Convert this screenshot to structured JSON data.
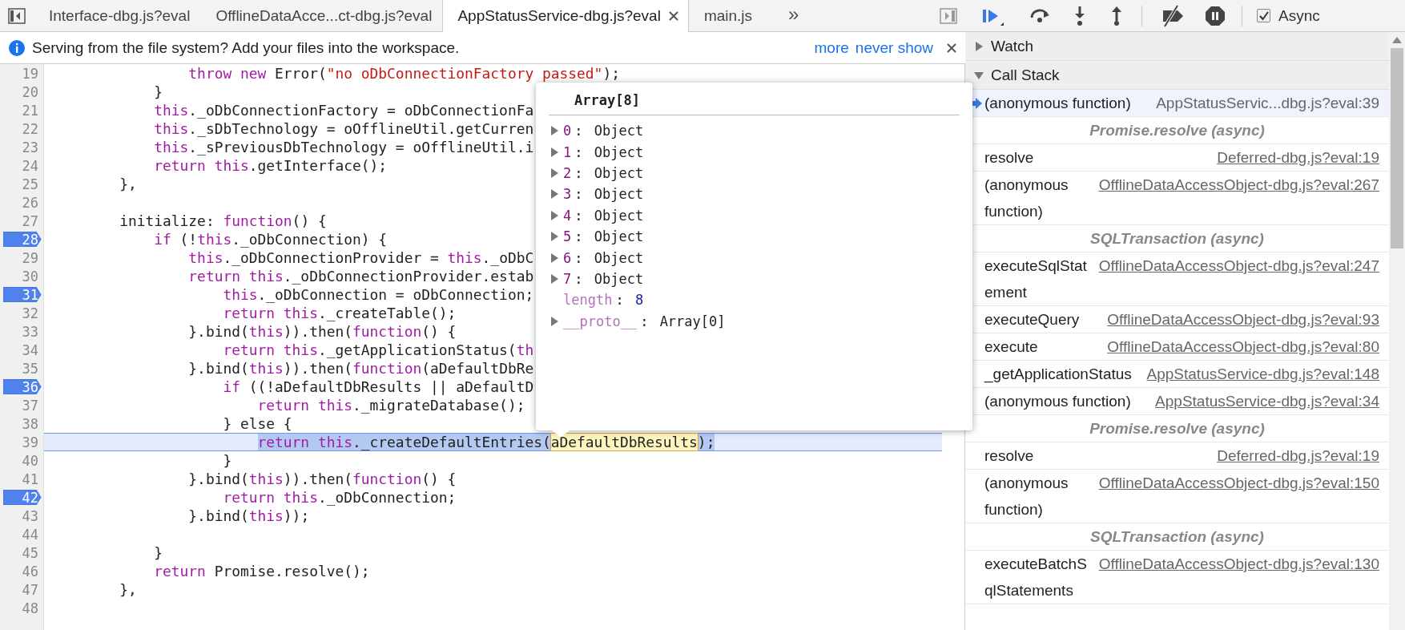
{
  "tabs": [
    {
      "label": "Interface-dbg.js?eval",
      "selected": false
    },
    {
      "label": "OfflineDataAcce...ct-dbg.js?eval",
      "selected": false
    },
    {
      "label": "AppStatusService-dbg.js?eval",
      "selected": true
    },
    {
      "label": "main.js",
      "selected": false
    }
  ],
  "more_tabs": "»",
  "info_bar": {
    "message": "Serving from the file system? Add your files into the workspace.",
    "links": [
      "more",
      "never show"
    ]
  },
  "editor": {
    "lines": [
      {
        "number": "19",
        "breakpoint": false,
        "current": false,
        "tokens": [
          {
            "text": "                throw new",
            "kind": "keyword"
          },
          {
            "text": " Error(",
            "kind": "plain"
          },
          {
            "text": "\"no oDbConnectionFactory passed\"",
            "kind": "string"
          },
          {
            "text": ");",
            "kind": "plain"
          }
        ]
      },
      {
        "number": "20",
        "breakpoint": false,
        "current": false,
        "tokens": [
          {
            "text": "            }",
            "kind": "plain"
          }
        ]
      },
      {
        "number": "21",
        "breakpoint": false,
        "current": false,
        "tokens": [
          {
            "text": "            this",
            "kind": "keyword"
          },
          {
            "text": "._oDbConnectionFactory = oDbConnectionFa",
            "kind": "plain"
          }
        ]
      },
      {
        "number": "22",
        "breakpoint": false,
        "current": false,
        "tokens": [
          {
            "text": "            this",
            "kind": "keyword"
          },
          {
            "text": "._sDbTechnology = oOfflineUtil.getCurren",
            "kind": "plain"
          }
        ]
      },
      {
        "number": "23",
        "breakpoint": false,
        "current": false,
        "tokens": [
          {
            "text": "            this",
            "kind": "keyword"
          },
          {
            "text": "._sPreviousDbTechnology = oOfflineUtil.i",
            "kind": "plain"
          }
        ]
      },
      {
        "number": "24",
        "breakpoint": false,
        "current": false,
        "tokens": [
          {
            "text": "            return this",
            "kind": "keyword"
          },
          {
            "text": ".getInterface();",
            "kind": "plain"
          }
        ]
      },
      {
        "number": "25",
        "breakpoint": false,
        "current": false,
        "tokens": [
          {
            "text": "        },",
            "kind": "plain"
          }
        ]
      },
      {
        "number": "26",
        "breakpoint": false,
        "current": false
      },
      {
        "number": "27",
        "breakpoint": false,
        "current": false,
        "tokens": [
          {
            "text": "        initialize: ",
            "kind": "plain"
          },
          {
            "text": "function",
            "kind": "keyword"
          },
          {
            "text": "() {",
            "kind": "plain"
          }
        ]
      },
      {
        "number": "28",
        "breakpoint": true,
        "current": false,
        "tokens": [
          {
            "text": "            if",
            "kind": "keyword"
          },
          {
            "text": " (!",
            "kind": "plain"
          },
          {
            "text": "this",
            "kind": "keyword"
          },
          {
            "text": "._oDbConnection) {",
            "kind": "plain"
          }
        ]
      },
      {
        "number": "29",
        "breakpoint": false,
        "current": false,
        "tokens": [
          {
            "text": "                this",
            "kind": "keyword"
          },
          {
            "text": "._oDbConnectionProvider = ",
            "kind": "plain"
          },
          {
            "text": "this",
            "kind": "keyword"
          },
          {
            "text": "._oDbC",
            "kind": "plain"
          }
        ]
      },
      {
        "number": "30",
        "breakpoint": false,
        "current": false,
        "tokens": [
          {
            "text": "                return this",
            "kind": "keyword"
          },
          {
            "text": "._oDbConnectionProvider.estab",
            "kind": "plain"
          }
        ]
      },
      {
        "number": "31",
        "breakpoint": true,
        "current": false,
        "tokens": [
          {
            "text": "                    this",
            "kind": "keyword"
          },
          {
            "text": "._oDbConnection = oDbConnection;",
            "kind": "plain"
          }
        ]
      },
      {
        "number": "32",
        "breakpoint": false,
        "current": false,
        "tokens": [
          {
            "text": "                    return this",
            "kind": "keyword"
          },
          {
            "text": "._createTable();",
            "kind": "plain"
          }
        ]
      },
      {
        "number": "33",
        "breakpoint": false,
        "current": false,
        "tokens": [
          {
            "text": "                }.bind(",
            "kind": "plain"
          },
          {
            "text": "this",
            "kind": "keyword"
          },
          {
            "text": ")).then(",
            "kind": "plain"
          },
          {
            "text": "function",
            "kind": "keyword"
          },
          {
            "text": "() {",
            "kind": "plain"
          }
        ]
      },
      {
        "number": "34",
        "breakpoint": false,
        "current": false,
        "tokens": [
          {
            "text": "                    return this",
            "kind": "keyword"
          },
          {
            "text": "._getApplicationStatus(",
            "kind": "plain"
          },
          {
            "text": "th",
            "kind": "keyword"
          }
        ]
      },
      {
        "number": "35",
        "breakpoint": false,
        "current": false,
        "tokens": [
          {
            "text": "                }.bind(",
            "kind": "plain"
          },
          {
            "text": "this",
            "kind": "keyword"
          },
          {
            "text": ")).then(",
            "kind": "plain"
          },
          {
            "text": "function",
            "kind": "keyword"
          },
          {
            "text": "(aDefaultDbRe",
            "kind": "plain"
          }
        ]
      },
      {
        "number": "36",
        "breakpoint": true,
        "current": false,
        "tokens": [
          {
            "text": "                    if",
            "kind": "keyword"
          },
          {
            "text": " ((!aDefaultDbResults || aDefaultD",
            "kind": "plain"
          }
        ]
      },
      {
        "number": "37",
        "breakpoint": false,
        "current": false,
        "tokens": [
          {
            "text": "                        return this",
            "kind": "keyword"
          },
          {
            "text": "._migrateDatabase();",
            "kind": "plain"
          }
        ]
      },
      {
        "number": "38",
        "breakpoint": false,
        "current": false,
        "tokens": [
          {
            "text": "                    } else {",
            "kind": "plain"
          }
        ]
      },
      {
        "number": "39",
        "breakpoint": false,
        "current": true,
        "tokens": [
          {
            "text": "                        return this",
            "kind": "keyword",
            "in_selection": true
          },
          {
            "text": "._createDefaultEntries(",
            "kind": "plain",
            "in_selection": true
          },
          {
            "text": "aDefaultDbResults",
            "kind": "plain",
            "hovered": true
          },
          {
            "text": ");",
            "kind": "plain",
            "in_selection": true
          }
        ]
      },
      {
        "number": "40",
        "breakpoint": false,
        "current": false,
        "tokens": [
          {
            "text": "                    }",
            "kind": "plain"
          }
        ]
      },
      {
        "number": "41",
        "breakpoint": false,
        "current": false,
        "tokens": [
          {
            "text": "                }.bind(",
            "kind": "plain"
          },
          {
            "text": "this",
            "kind": "keyword"
          },
          {
            "text": ")).then(",
            "kind": "plain"
          },
          {
            "text": "function",
            "kind": "keyword"
          },
          {
            "text": "() {",
            "kind": "plain"
          }
        ]
      },
      {
        "number": "42",
        "breakpoint": true,
        "current": false,
        "tokens": [
          {
            "text": "                    return this",
            "kind": "keyword"
          },
          {
            "text": "._oDbConnection;",
            "kind": "plain"
          }
        ]
      },
      {
        "number": "43",
        "breakpoint": false,
        "current": false,
        "tokens": [
          {
            "text": "                }.bind(",
            "kind": "plain"
          },
          {
            "text": "this",
            "kind": "keyword"
          },
          {
            "text": "));",
            "kind": "plain"
          }
        ]
      },
      {
        "number": "44",
        "breakpoint": false,
        "current": false
      },
      {
        "number": "45",
        "breakpoint": false,
        "current": false,
        "tokens": [
          {
            "text": "            }",
            "kind": "plain"
          }
        ]
      },
      {
        "number": "46",
        "breakpoint": false,
        "current": false,
        "tokens": [
          {
            "text": "            return",
            "kind": "keyword"
          },
          {
            "text": " Promise.resolve();",
            "kind": "plain"
          }
        ]
      },
      {
        "number": "47",
        "breakpoint": false,
        "current": false,
        "tokens": [
          {
            "text": "        },",
            "kind": "plain"
          }
        ]
      },
      {
        "number": "48",
        "breakpoint": false,
        "current": false
      }
    ]
  },
  "popover": {
    "title": "Array[8]",
    "entries": [
      {
        "key": "0",
        "sep": ":",
        "value": "Object",
        "expandable": true,
        "kind": "index"
      },
      {
        "key": "1",
        "sep": ":",
        "value": "Object",
        "expandable": true,
        "kind": "index"
      },
      {
        "key": "2",
        "sep": ":",
        "value": "Object",
        "expandable": true,
        "kind": "index"
      },
      {
        "key": "3",
        "sep": ":",
        "value": "Object",
        "expandable": true,
        "kind": "index"
      },
      {
        "key": "4",
        "sep": ":",
        "value": "Object",
        "expandable": true,
        "kind": "index"
      },
      {
        "key": "5",
        "sep": ":",
        "value": "Object",
        "expandable": true,
        "kind": "index"
      },
      {
        "key": "6",
        "sep": ":",
        "value": "Object",
        "expandable": true,
        "kind": "index"
      },
      {
        "key": "7",
        "sep": ":",
        "value": "Object",
        "expandable": true,
        "kind": "index"
      },
      {
        "key": "length",
        "sep": ":",
        "value": "8",
        "expandable": false,
        "kind": "internal_number"
      },
      {
        "key": "__proto__",
        "sep": ":",
        "value": "Array[0]",
        "expandable": true,
        "kind": "internal"
      }
    ]
  },
  "debugger": {
    "async": {
      "label": "Async",
      "checked": true
    },
    "sections": [
      {
        "title": "Watch",
        "expanded": false
      },
      {
        "title": "Call Stack",
        "expanded": true,
        "frames": [
          {
            "kind": "frame",
            "name": "(anonymous function)",
            "location": "AppStatusServic...dbg.js?eval:39",
            "selected": true
          },
          {
            "kind": "async",
            "name": "Promise.resolve (async)"
          },
          {
            "kind": "frame",
            "name": "resolve",
            "location": "Deferred-dbg.js?eval:19",
            "selected": false
          },
          {
            "kind": "frame",
            "name": "(anonymous function)",
            "location": "OfflineDataAccessObject-dbg.js?eval:267",
            "selected": false
          },
          {
            "kind": "async",
            "name": "SQLTransaction (async)"
          },
          {
            "kind": "frame",
            "name": "executeSqlStatement",
            "location": "OfflineDataAccessObject-dbg.js?eval:247",
            "selected": false
          },
          {
            "kind": "frame",
            "name": "executeQuery",
            "location": "OfflineDataAccessObject-dbg.js?eval:93",
            "selected": false
          },
          {
            "kind": "frame",
            "name": "execute",
            "location": "OfflineDataAccessObject-dbg.js?eval:80",
            "selected": false
          },
          {
            "kind": "frame",
            "name": "_getApplicationStatus",
            "location": "AppStatusService-dbg.js?eval:148",
            "selected": false
          },
          {
            "kind": "frame",
            "name": "(anonymous function)",
            "location": "AppStatusService-dbg.js?eval:34",
            "selected": false
          },
          {
            "kind": "async",
            "name": "Promise.resolve (async)"
          },
          {
            "kind": "frame",
            "name": "resolve",
            "location": "Deferred-dbg.js?eval:19",
            "selected": false
          },
          {
            "kind": "frame",
            "name": "(anonymous function)",
            "location": "OfflineDataAccessObject-dbg.js?eval:150",
            "selected": false
          },
          {
            "kind": "async",
            "name": "SQLTransaction (async)"
          },
          {
            "kind": "frame",
            "name": "executeBatchSqlStatements",
            "location": "OfflineDataAccessObject-dbg.js?eval:130",
            "selected": false
          }
        ]
      }
    ]
  }
}
